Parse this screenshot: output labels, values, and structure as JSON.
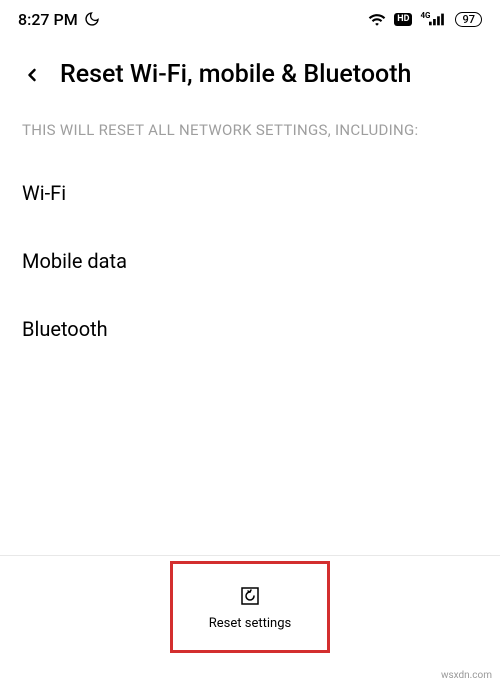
{
  "status_bar": {
    "time": "8:27 PM",
    "battery": "97"
  },
  "header": {
    "title": "Reset Wi-Fi, mobile & Bluetooth"
  },
  "description": "THIS WILL RESET ALL NETWORK SETTINGS, INCLUDING:",
  "items": [
    "Wi-Fi",
    "Mobile data",
    "Bluetooth"
  ],
  "reset_button": {
    "label": "Reset settings"
  },
  "watermark": "wsxdn.com"
}
